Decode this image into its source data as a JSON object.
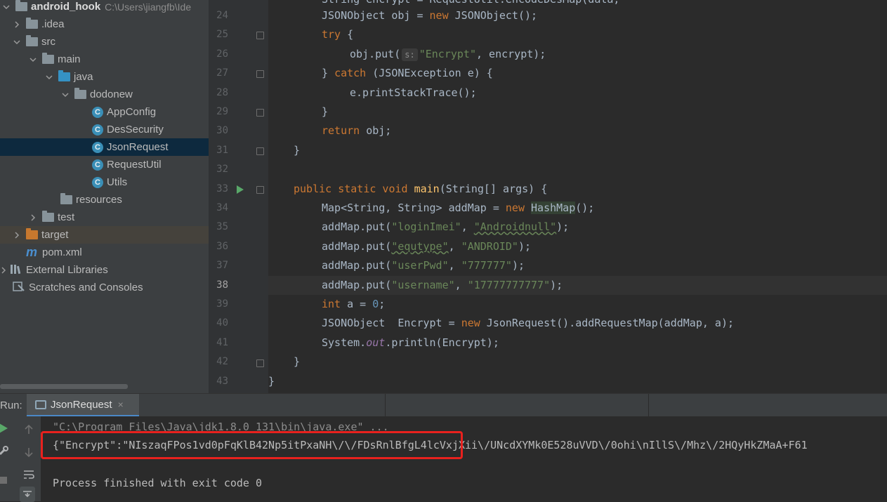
{
  "project": {
    "root_name": "android_hook",
    "root_path": "C:\\Users\\jiangfb\\Ide",
    "items": [
      {
        "label": ".idea",
        "icon": "folder-icon"
      },
      {
        "label": "src",
        "icon": "folder-icon"
      },
      {
        "label": "main",
        "icon": "folder-icon"
      },
      {
        "label": "java",
        "icon": "source-folder-icon"
      },
      {
        "label": "dodonew",
        "icon": "package-icon"
      },
      {
        "label": "AppConfig",
        "icon": "class-icon"
      },
      {
        "label": "DesSecurity",
        "icon": "class-icon"
      },
      {
        "label": "JsonRequest",
        "icon": "class-runnable-icon"
      },
      {
        "label": "RequestUtil",
        "icon": "class-icon"
      },
      {
        "label": "Utils",
        "icon": "class-icon"
      },
      {
        "label": "resources",
        "icon": "resources-folder-icon"
      },
      {
        "label": "test",
        "icon": "folder-icon"
      },
      {
        "label": "target",
        "icon": "excluded-folder-icon"
      },
      {
        "label": "pom.xml",
        "icon": "maven-icon"
      },
      {
        "label": "External Libraries",
        "icon": "libraries-icon"
      },
      {
        "label": "Scratches and Consoles",
        "icon": "scratches-icon"
      }
    ]
  },
  "editor": {
    "line_numbers": [
      "24",
      "25",
      "26",
      "27",
      "28",
      "29",
      "30",
      "31",
      "32",
      "33",
      "34",
      "35",
      "36",
      "37",
      "38",
      "39",
      "40",
      "41",
      "42",
      "43"
    ],
    "current_line": "38",
    "top_partial": "String encrypt = RequestUtil.encodeDesMap(data, ",
    "l24": {
      "a": "JSONObject obj = ",
      "new": "new",
      "b": " JSONObject();"
    },
    "l25": {
      "kw": "try",
      "b": " {"
    },
    "l26": {
      "a": "obj.put(",
      "hint": "s:",
      "str": "\"Encrypt\"",
      "b": ", encrypt);"
    },
    "l27": {
      "a": "} ",
      "kw": "catch",
      "b": " (JSONException e) {"
    },
    "l28": {
      "a": "e.printStackTrace();"
    },
    "l29": {
      "a": "}"
    },
    "l30": {
      "kw": "return",
      "b": " obj;"
    },
    "l31": {
      "a": "}"
    },
    "l33": {
      "kw": "public static void",
      "fn": "main",
      "b": "(String[] args) {"
    },
    "l34": {
      "a": "Map<String, String> addMap = ",
      "new": "new",
      "cls": "HashMap",
      "b": "();"
    },
    "l35": {
      "a": "addMap.put(",
      "s1": "\"loginImei\"",
      "sep": ", ",
      "s2": "\"Androidnull\"",
      "b": ");"
    },
    "l36": {
      "a": "addMap.put(",
      "s1": "\"equtype\"",
      "sep": ", ",
      "s2": "\"ANDROID\"",
      "b": ");"
    },
    "l37": {
      "a": "addMap.put(",
      "s1": "\"userPwd\"",
      "sep": ", ",
      "s2": "\"777777\"",
      "b": ");"
    },
    "l38": {
      "a": "addMap.put(",
      "s1": "\"username\"",
      "sep": ", ",
      "s2": "\"17777777777\"",
      "b": ");"
    },
    "l39": {
      "kw": "int",
      "a": " a = ",
      "num": "0",
      "b": ";"
    },
    "l40": {
      "a": "JSONObject  Encrypt = ",
      "new": "new",
      "b": " JsonRequest().addRequestMap(addMap, a);"
    },
    "l41": {
      "a": "System.",
      "fld": "out",
      "b": ".println(Encrypt);"
    },
    "l42": {
      "a": "}"
    },
    "l43": {
      "a": "}"
    }
  },
  "run": {
    "label": "Run:",
    "tab_label": "JsonRequest",
    "tab_close": "×",
    "command": "\"C:\\Program Files\\Java\\jdk1.8.0_131\\bin\\java.exe\" ...",
    "output": "{\"Encrypt\":\"NIszaqFPos1vd0pFqKlB42Np5itPxaNH\\/\\/FDsRnlBfgL4lcVxjXii\\/UNcdXYMk0E528uVVD\\/0ohi\\nIllS\\/Mhz\\/2HQyHkZMaA+F61",
    "exit": "Process finished with exit code 0",
    "highlight_color": "#e8211e"
  },
  "colors": {
    "keyword": "#cc7832",
    "string": "#6a8759",
    "number": "#6897bb",
    "function": "#ffc66d",
    "selection": "#0d293e"
  }
}
